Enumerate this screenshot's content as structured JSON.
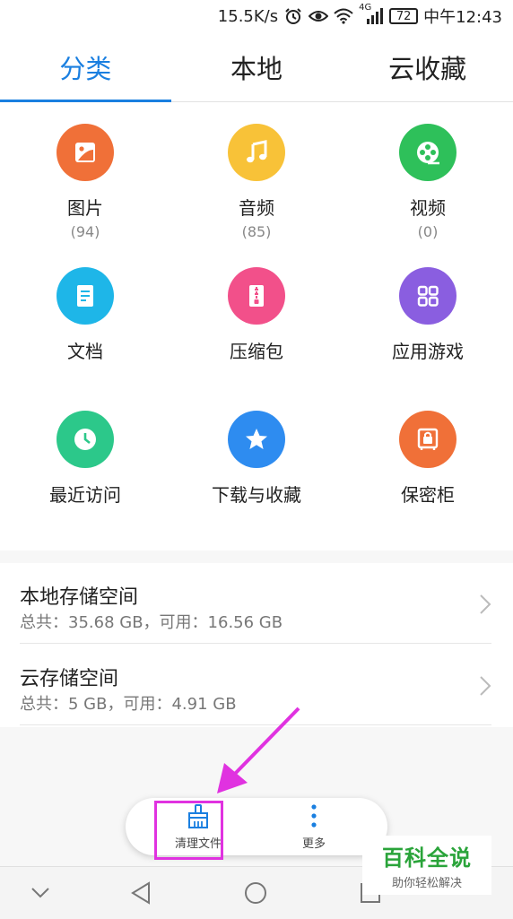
{
  "status_bar": {
    "speed": "15.5K/s",
    "network": "4G",
    "battery": "72",
    "time": "中午12:43"
  },
  "tabs": [
    {
      "label": "分类",
      "active": true
    },
    {
      "label": "本地",
      "active": false
    },
    {
      "label": "云收藏",
      "active": false
    }
  ],
  "categories": [
    {
      "label": "图片",
      "count": "(94)",
      "icon": "image-icon",
      "color": "#f07038"
    },
    {
      "label": "音频",
      "count": "(85)",
      "icon": "music-icon",
      "color": "#f8c238"
    },
    {
      "label": "视频",
      "count": "(0)",
      "icon": "video-reel-icon",
      "color": "#2ec05a"
    },
    {
      "label": "文档",
      "icon": "document-icon",
      "color": "#1eb6e8"
    },
    {
      "label": "压缩包",
      "icon": "archive-icon",
      "color": "#f2508a"
    },
    {
      "label": "应用游戏",
      "icon": "apps-grid-icon",
      "color": "#8a5ee0"
    },
    {
      "label": "最近访问",
      "icon": "clock-icon",
      "color": "#2cc88a"
    },
    {
      "label": "下载与收藏",
      "icon": "star-icon",
      "color": "#2e8cf0"
    },
    {
      "label": "保密柜",
      "icon": "safe-icon",
      "color": "#f07038"
    }
  ],
  "storage": [
    {
      "title": "本地存储空间",
      "detail": "总共：35.68 GB，可用：16.56 GB"
    },
    {
      "title": "云存储空间",
      "detail": "总共：5 GB，可用：4.91 GB"
    }
  ],
  "bottom_actions": {
    "clean_label": "清理文件",
    "more_label": "更多"
  },
  "watermark": {
    "title": "百科全说",
    "subtitle": "助你轻松解决"
  },
  "colors": {
    "accent": "#1a7fe0",
    "highlight": "#e032e0"
  }
}
